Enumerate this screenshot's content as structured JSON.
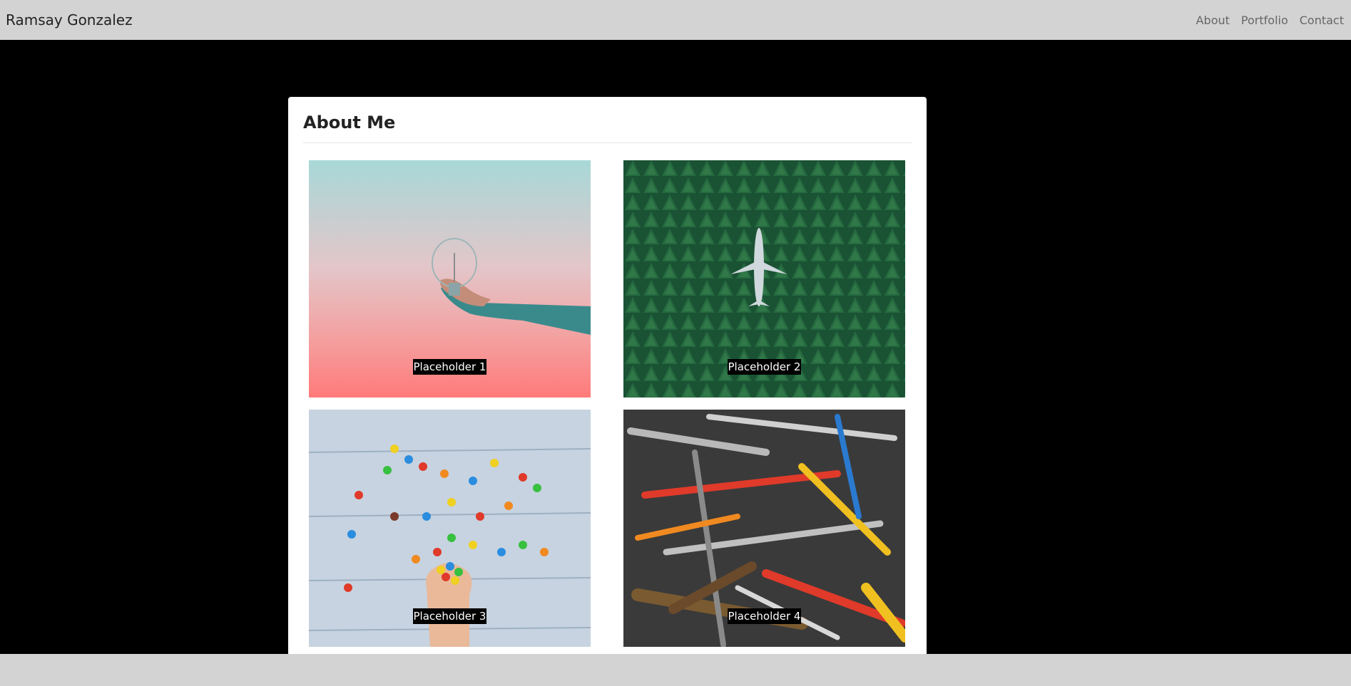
{
  "navbar": {
    "brand": "Ramsay Gonzalez",
    "links": [
      "About",
      "Portfolio",
      "Contact"
    ]
  },
  "about": {
    "title": "About Me",
    "tiles": [
      {
        "caption": "Placeholder 1",
        "subject": "lightbulb"
      },
      {
        "caption": "Placeholder 2",
        "subject": "airplane-forest"
      },
      {
        "caption": "Placeholder 3",
        "subject": "candies"
      },
      {
        "caption": "Placeholder 4",
        "subject": "tools"
      }
    ]
  },
  "colors": {
    "navbar_bg": "#d3d3d3",
    "page_bg": "#000000",
    "card_bg": "#ffffff",
    "caption_bg": "#000000"
  }
}
